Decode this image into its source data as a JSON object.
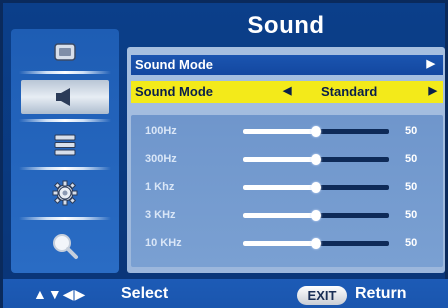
{
  "title": "Sound",
  "sidebar": {
    "items": [
      {
        "icon": "picture-icon"
      },
      {
        "icon": "speaker-icon",
        "selected": true
      },
      {
        "icon": "setup-icon"
      },
      {
        "icon": "gear-icon"
      },
      {
        "icon": "magnifier-icon"
      }
    ]
  },
  "menu": {
    "header_label": "Sound Mode",
    "header_arrow": "▶",
    "selected": {
      "label": "Sound Mode",
      "left_arrow": "◀",
      "value": "Standard",
      "right_arrow": "▶"
    }
  },
  "equalizer": [
    {
      "label": "100Hz",
      "value": "50",
      "level": 0.5
    },
    {
      "label": "300Hz",
      "value": "50",
      "level": 0.5
    },
    {
      "label": "1 Khz",
      "value": "50",
      "level": 0.5
    },
    {
      "label": "3 KHz",
      "value": "50",
      "level": 0.5
    },
    {
      "label": "10 KHz",
      "value": "50",
      "level": 0.5
    }
  ],
  "footer": {
    "nav_arrows": "▲▼◀▶",
    "select_label": "Select",
    "exit_label": "EXIT",
    "return_label": "Return"
  },
  "colors": {
    "selected_row": "#f3ea1a",
    "header_row": "#1b55b0",
    "background": "#0b3f8a"
  }
}
